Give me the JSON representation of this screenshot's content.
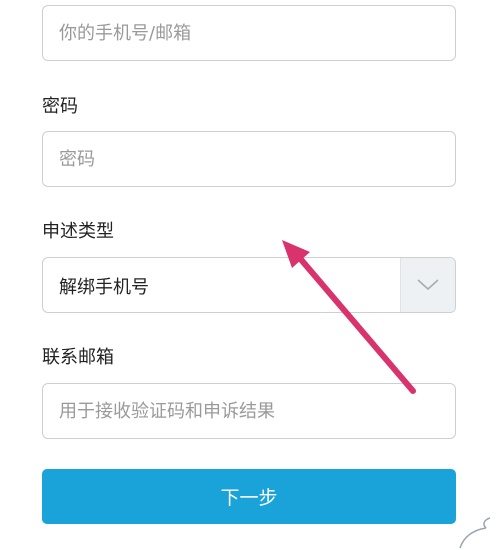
{
  "form": {
    "account_field": {
      "placeholder": "你的手机号/邮箱"
    },
    "password_label": "密码",
    "password_field": {
      "placeholder": "密码"
    },
    "complaint_type_label": "申述类型",
    "complaint_type_select": {
      "selected": "解绑手机号"
    },
    "contact_email_label": "联系邮箱",
    "contact_email_field": {
      "placeholder": "用于接收验证码和申诉结果"
    },
    "next_button_label": "下一步"
  },
  "colors": {
    "primary_button": "#1aa3d9",
    "annotation_arrow": "#d9336e"
  },
  "icons": {
    "select_arrow": "chevron-down-icon",
    "annotation": "annotation-arrow"
  }
}
